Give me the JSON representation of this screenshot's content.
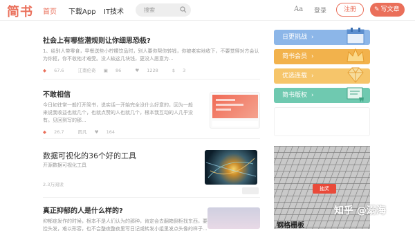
{
  "header": {
    "logo": "简书",
    "nav": [
      {
        "label": "首页"
      },
      {
        "label": "下载App"
      },
      {
        "label": "IT技术"
      }
    ],
    "search_placeholder": "搜索",
    "aa": "Aa",
    "login": "登录",
    "register": "注册",
    "write": "写文章"
  },
  "articles": [
    {
      "title": "社会上有哪些潜规则让你细思恐极?",
      "abstract": "1、给别人带零食，早餐送些小柠檬饮品时，别人要你帮你转钱，你被老实地收下，不要觉得对方会认为你抠，你不收他才难受。没人缺这几块钱，更没人愿意为...",
      "meta": {
        "score": "67.6",
        "author": "江南伦奇",
        "comments": "86",
        "likes": "1228",
        "rewards": "3"
      }
    },
    {
      "title": "不敢相信",
      "abstract": "今日如往常一般打开简书，说实话一开始完全没什么好意的，因为一般来说我收益也就几个，也就点赞的人也就几个，根本我互动的人几乎没有。见回到写的那...",
      "meta": {
        "score": "26.7",
        "author": "雨凡",
        "likes": "164"
      }
    },
    {
      "title": "数据可视化的36个好的工具",
      "abstract": "开源数据可视化工具",
      "meta": {
        "reads": "2.3万阅读"
      }
    },
    {
      "title": "真正抑郁的人是什么样的?",
      "abstract": "抑郁症发作的时候，根本不是人们认为的那种，肯定会去翻箱倒柜找东西，要捡头发，难以形容，也不会整夜整夜里写日记或转发小组里发点头像的样子..."
    }
  ],
  "sidebar": {
    "buttons": [
      {
        "label": "日更挑战",
        "color": "#8cb6e8"
      },
      {
        "label": "简书会员",
        "color": "#f2b24c"
      },
      {
        "label": "优选连载",
        "color": "#f6c56a"
      },
      {
        "label": "简书版权",
        "color": "#6fc9b0"
      }
    ],
    "ad_tag": "抽奖",
    "ad_caption": "钢格栅板",
    "watermark": "知乎 @溺海"
  }
}
